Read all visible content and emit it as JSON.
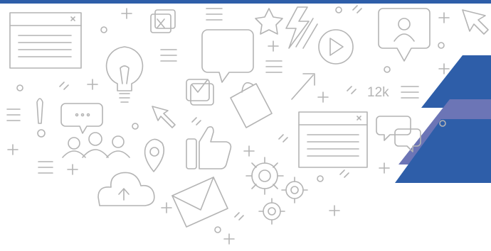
{
  "theme": {
    "line_color": "#b4b4b4",
    "brand_dark": "#2e5ea9",
    "brand_mid": "#6c75b6",
    "background": "#ffffff"
  },
  "icons": [
    "browser-window-icon",
    "close-box-icon",
    "lightbulb-icon",
    "speech-bubble-icon",
    "star-icon",
    "lightning-icon",
    "play-button-icon",
    "profile-chat-icon",
    "cursor-arrow-icon",
    "checkbox-icon",
    "shopping-bag-icon",
    "exclamation-icon",
    "typing-bubble-icon",
    "users-icon",
    "location-pin-icon",
    "thumbs-up-icon",
    "cloud-upload-icon",
    "envelope-icon",
    "gears-icon",
    "chat-bubbles-icon"
  ],
  "counter": {
    "text": "12k"
  }
}
